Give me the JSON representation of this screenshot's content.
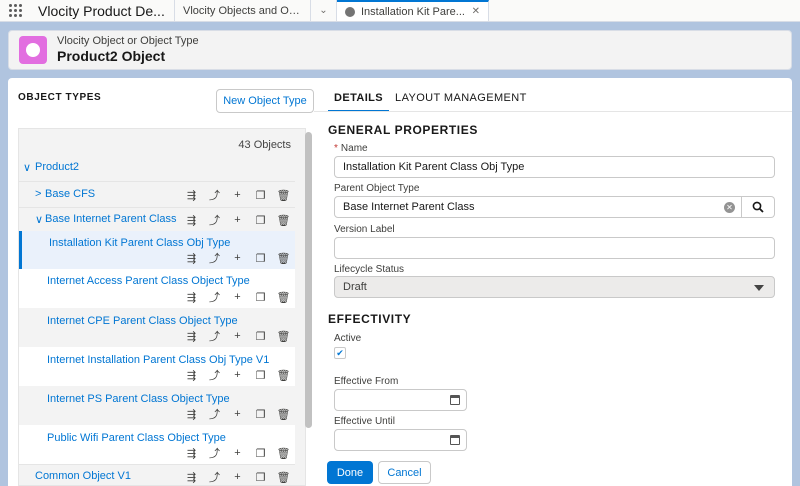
{
  "app": {
    "name": "Vlocity Product De..."
  },
  "tabs": [
    {
      "label": "Vlocity Objects and Obje..."
    },
    {
      "label": "Installation Kit Pare..."
    }
  ],
  "header": {
    "subtitle": "Vlocity Object or Object Type",
    "title": "Product2 Object"
  },
  "left": {
    "title": "OBJECT TYPES",
    "new_button": "New Object Type",
    "count": "43 Objects",
    "nodes": [
      {
        "label": "Product2",
        "arrow": "∨",
        "expanded": true
      },
      {
        "label": "Base CFS",
        "arrow": ">"
      },
      {
        "label": "Base Internet Parent Class",
        "arrow": "∨",
        "expanded": true
      },
      {
        "label": "Installation Kit Parent Class Obj Type",
        "selected": true
      },
      {
        "label": "Internet Access Parent Class Object Type"
      },
      {
        "label": "Internet CPE Parent Class Object Type"
      },
      {
        "label": "Internet Installation Parent Class Obj Type V1"
      },
      {
        "label": "Internet PS Parent Class Object Type"
      },
      {
        "label": "Public Wifi Parent Class Object Type"
      },
      {
        "label": "Common Object V1"
      }
    ]
  },
  "right": {
    "tabs": [
      {
        "label": "DETAILS"
      },
      {
        "label": "LAYOUT MANAGEMENT"
      }
    ],
    "general_title": "GENERAL PROPERTIES",
    "name_label": "Name",
    "name_value": "Installation Kit Parent Class Obj Type",
    "parent_label": "Parent Object Type",
    "parent_value": "Base Internet Parent Class",
    "version_label": "Version Label",
    "version_value": "",
    "lifecycle_label": "Lifecycle Status",
    "lifecycle_value": "Draft",
    "effectivity_title": "EFFECTIVITY",
    "active_label": "Active",
    "active_checked": true,
    "from_label": "Effective From",
    "until_label": "Effective Until",
    "done": "Done",
    "cancel": "Cancel"
  },
  "colors": {
    "brand": "#0176d3",
    "object_icon": "#e26ee0",
    "page_bg": "#b0c4df"
  },
  "icons": [
    "app-launcher-icon",
    "globe-icon",
    "close-icon",
    "chevron-down-icon",
    "clear-icon",
    "search-icon",
    "calendar-icon",
    "checkmark-icon",
    "reorder-icon",
    "move-icon",
    "add-icon",
    "copy-icon",
    "delete-icon"
  ]
}
